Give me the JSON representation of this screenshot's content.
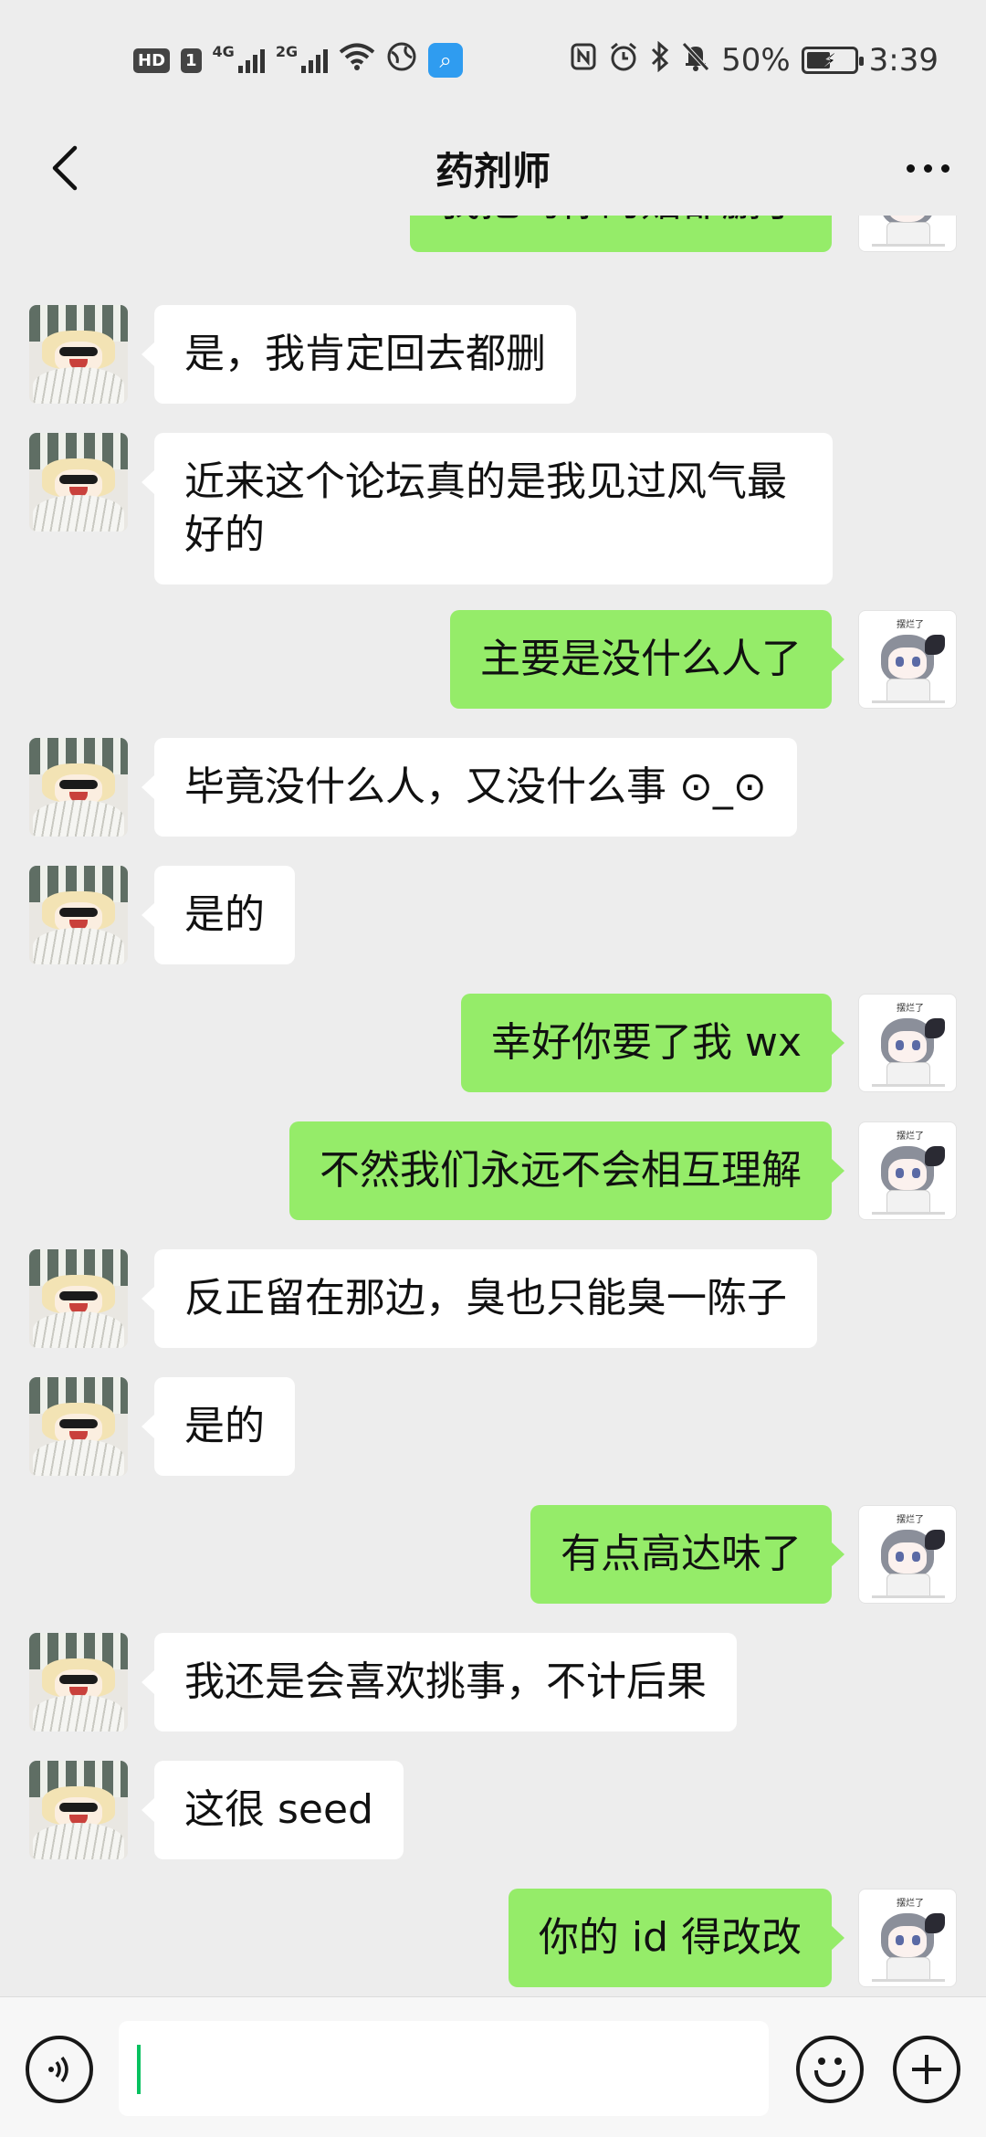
{
  "status_bar": {
    "hd_label": "HD",
    "sim_label": "1",
    "net1_label": "4G",
    "net2_label": "2G",
    "battery_percent": "50%",
    "battery_level": 0.5,
    "time": "3:39"
  },
  "header": {
    "title": "药剂师"
  },
  "colors": {
    "background": "#ededed",
    "self_bubble": "#95ec69",
    "other_bubble": "#ffffff",
    "caret": "#07c160"
  },
  "messages": [
    {
      "sender": "self",
      "text": "我把骂你的贴都删了"
    },
    {
      "sender": "other",
      "text": "是，我肯定回去都删"
    },
    {
      "sender": "other",
      "text": "近来这个论坛真的是我见过风气最好的"
    },
    {
      "sender": "self",
      "text": "主要是没什么人了"
    },
    {
      "sender": "other",
      "text": "毕竟没什么人，又没什么事 ⊙_⊙"
    },
    {
      "sender": "other",
      "text": "是的"
    },
    {
      "sender": "self",
      "text": "幸好你要了我 wx"
    },
    {
      "sender": "self",
      "text": "不然我们永远不会相互理解"
    },
    {
      "sender": "other",
      "text": "反正留在那边，臭也只能臭一陈子"
    },
    {
      "sender": "other",
      "text": "是的"
    },
    {
      "sender": "self",
      "text": "有点高达味了"
    },
    {
      "sender": "other",
      "text": "我还是会喜欢挑事，不计后果"
    },
    {
      "sender": "other",
      "text": "这很 seed"
    },
    {
      "sender": "self",
      "text": "你的 id 得改改"
    }
  ],
  "self_avatar_caption": "摆烂了",
  "input": {
    "value": "",
    "voice_icon": "voice-icon",
    "emoji_icon": "emoji-icon",
    "plus_icon": "plus-icon"
  }
}
